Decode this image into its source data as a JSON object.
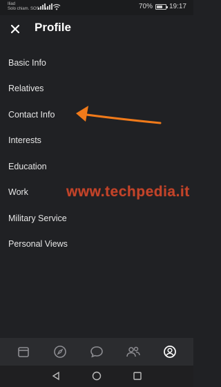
{
  "status_bar": {
    "carrier_line1": "Iliad",
    "carrier_line2": "Solo chiam. SOS",
    "battery_percent": "70%",
    "battery_level": 0.7,
    "time": "19:17"
  },
  "header": {
    "title": "Profile",
    "close_icon": "close-icon"
  },
  "menu": {
    "items": [
      {
        "label": "Basic Info"
      },
      {
        "label": "Relatives"
      },
      {
        "label": "Contact Info"
      },
      {
        "label": "Interests"
      },
      {
        "label": "Education"
      },
      {
        "label": "Work"
      },
      {
        "label": "Military Service"
      },
      {
        "label": "Personal Views"
      }
    ]
  },
  "watermark": "www.techpedia.it",
  "annotation": {
    "color": "#f07a1a",
    "points_to": "Contact Info"
  },
  "bottom_nav": {
    "icons": [
      "calendar-icon",
      "compass-icon",
      "chat-bubble-icon",
      "friends-icon",
      "profile-icon"
    ],
    "active": "profile-icon"
  },
  "system_nav": {
    "icons": [
      "back-icon",
      "home-icon",
      "recents-icon"
    ]
  },
  "colors": {
    "background": "#202124",
    "text": "#e6e6e6",
    "nav_bar": "#2b2c2f",
    "watermark": "#c2442a",
    "arrow": "#f07a1a"
  }
}
